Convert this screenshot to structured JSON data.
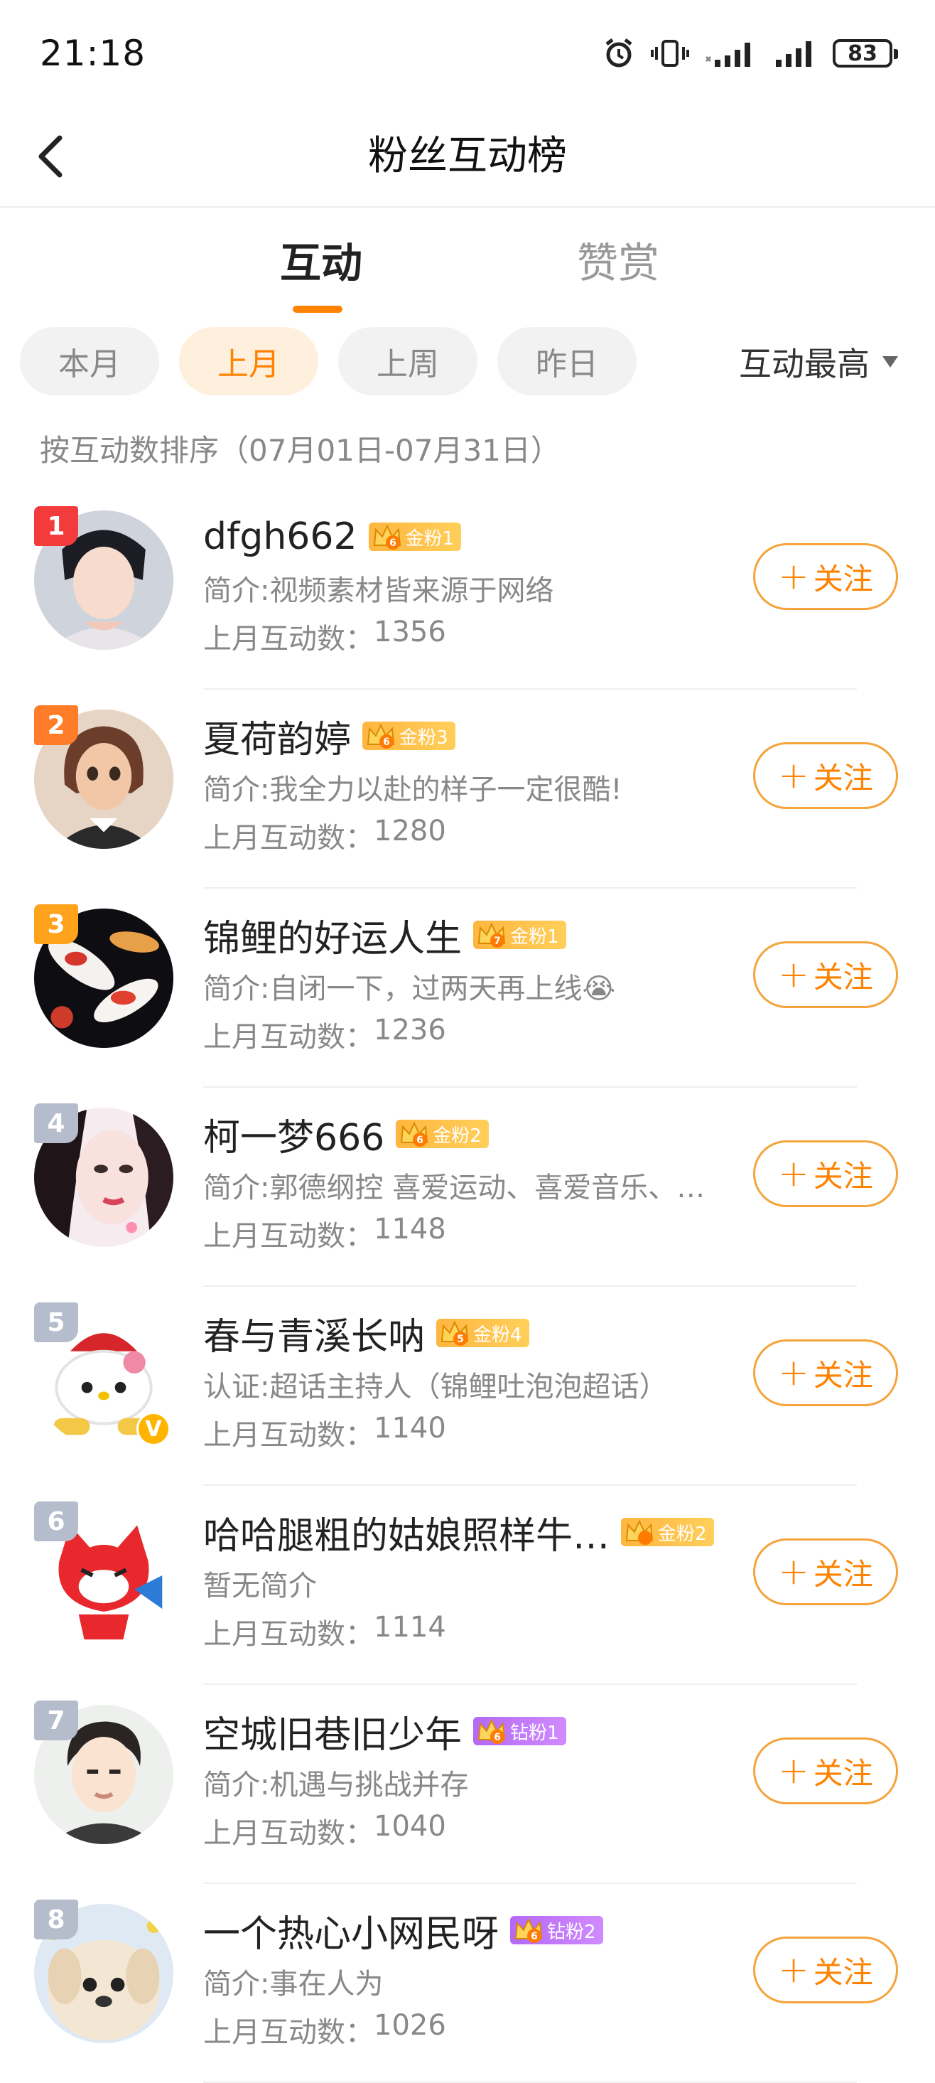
{
  "status_bar": {
    "time": "21:18",
    "battery": "83"
  },
  "header": {
    "title": "粉丝互动榜"
  },
  "tabs": [
    {
      "label": "互动"
    },
    {
      "label": "赞赏"
    }
  ],
  "filters": [
    {
      "label": "本月"
    },
    {
      "label": "上月"
    },
    {
      "label": "上周"
    },
    {
      "label": "昨日"
    }
  ],
  "active_filter": "上月",
  "sort": {
    "label": "互动最高"
  },
  "range_note": "按互动数排序（07月01日-07月31日）",
  "count_prefix": "上月互动数：",
  "follow_label": "关注",
  "colors": {
    "accent": "#ff8200",
    "gold_badge": "#ffbf4a",
    "diamond_badge": "#c07af8",
    "rank1": "#f33b3b",
    "rank2": "#ff7d28",
    "rank3": "#ffa21c",
    "rank_default": "#b5bccc"
  },
  "fans": [
    {
      "rank": "1",
      "name": "dfgh662",
      "badge": "金粉1",
      "badge_level": "6",
      "badge_type": "gold",
      "bio": "简介:视频素材皆来源于网络",
      "count": "1356"
    },
    {
      "rank": "2",
      "name": "夏荷韵婷",
      "badge": "金粉3",
      "badge_level": "6",
      "badge_type": "gold",
      "bio": "简介:我全力以赴的样子一定很酷!",
      "count": "1280"
    },
    {
      "rank": "3",
      "name": "锦鲤的好运人生",
      "badge": "金粉1",
      "badge_level": "7",
      "badge_type": "gold",
      "bio": "简介:自闭一下，过两天再上线😭",
      "count": "1236"
    },
    {
      "rank": "4",
      "name": "柯一梦666",
      "badge": "金粉2",
      "badge_level": "6",
      "badge_type": "gold",
      "bio": "简介:郭德纲控 喜爱运动、喜爱音乐、…",
      "count": "1148"
    },
    {
      "rank": "5",
      "name": "春与青溪长呐",
      "badge": "金粉4",
      "badge_level": "5",
      "badge_type": "gold",
      "bio": "认证:超话主持人（锦鲤吐泡泡超话）",
      "count": "1140"
    },
    {
      "rank": "6",
      "name": "哈哈腿粗的姑娘照样牛…",
      "badge": "金粉2",
      "badge_level": "",
      "badge_type": "gold",
      "bio": "暂无简介",
      "count": "1114"
    },
    {
      "rank": "7",
      "name": "空城旧巷旧少年",
      "badge": "钻粉1",
      "badge_level": "6",
      "badge_type": "diamond",
      "bio": "简介:机遇与挑战并存",
      "count": "1040"
    },
    {
      "rank": "8",
      "name": "一个热心小网民呀",
      "badge": "钻粉2",
      "badge_level": "6",
      "badge_type": "diamond",
      "bio": "简介:事在人为",
      "count": "1026"
    }
  ]
}
